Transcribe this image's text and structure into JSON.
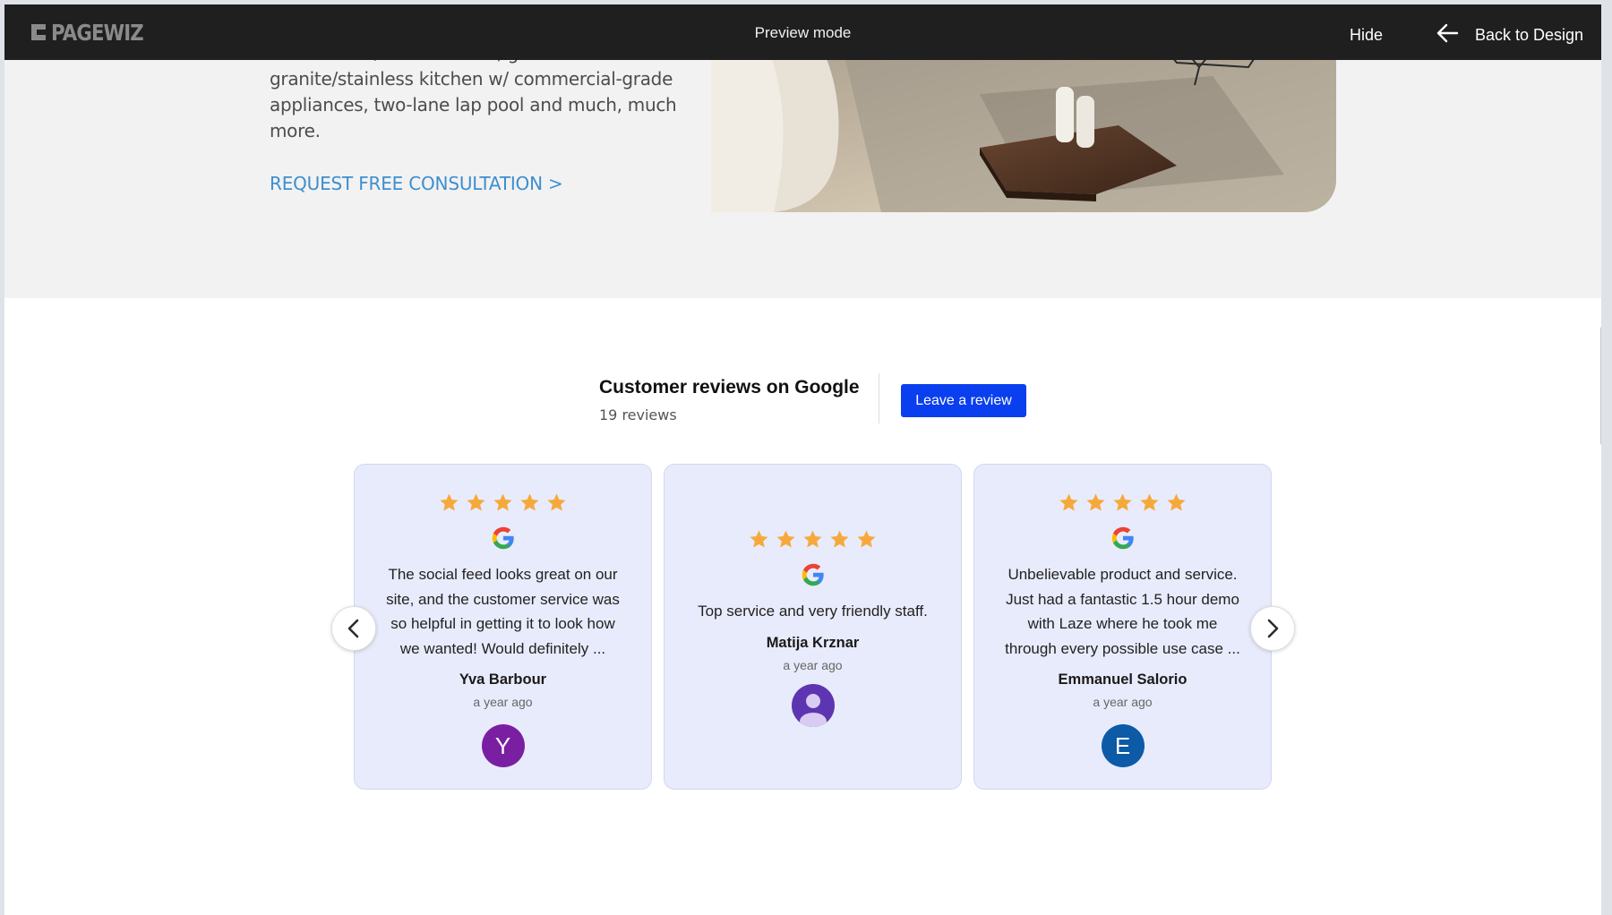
{
  "topbar": {
    "logo_text": "PAGEWIZ",
    "mode_label": "Preview mode",
    "hide_label": "Hide",
    "back_label": "Back to Design",
    "back_icon": "arrow-left-icon"
  },
  "hero": {
    "text_lines": [
      "bathroom w/ dual vanities, gourmet",
      "granite/stainless kitchen w/ commercial-grade",
      "appliances, two-lane lap pool and much, much",
      "more."
    ],
    "cta_label": "REQUEST FREE CONSULTATION >",
    "accent_color": "#3d8fcf"
  },
  "reviews": {
    "title": "Customer reviews on Google",
    "count_label": "19 reviews",
    "leave_review_label": "Leave a review",
    "button_color": "#0a3ff0",
    "star_color": "#f6a93b",
    "cards": [
      {
        "rating": 5,
        "text_lines": [
          "The social feed looks great on our",
          "site, and the customer service was",
          "so helpful in getting it to look how",
          "we wanted! Would definitely ..."
        ],
        "name": "Yva Barbour",
        "time": "a year ago",
        "avatar_letter": "Y",
        "avatar_color": "#7b1fa2"
      },
      {
        "rating": 5,
        "text_lines": [
          "Top service and very friendly staff."
        ],
        "name": "Matija Krznar",
        "time": "a year ago",
        "avatar_icon": "default-user-icon",
        "avatar_color": "#5e35b1"
      },
      {
        "rating": 5,
        "text_lines": [
          "Unbelievable product and service.",
          "Just had a fantastic 1.5 hour demo",
          "with Laze where he took me",
          "through every possible use case ..."
        ],
        "name": "Emmanuel Salorio",
        "time": "a year ago",
        "avatar_letter": "E",
        "avatar_color": "#0d5aa7"
      }
    ],
    "prev_icon": "chevron-left-icon",
    "next_icon": "chevron-right-icon"
  }
}
